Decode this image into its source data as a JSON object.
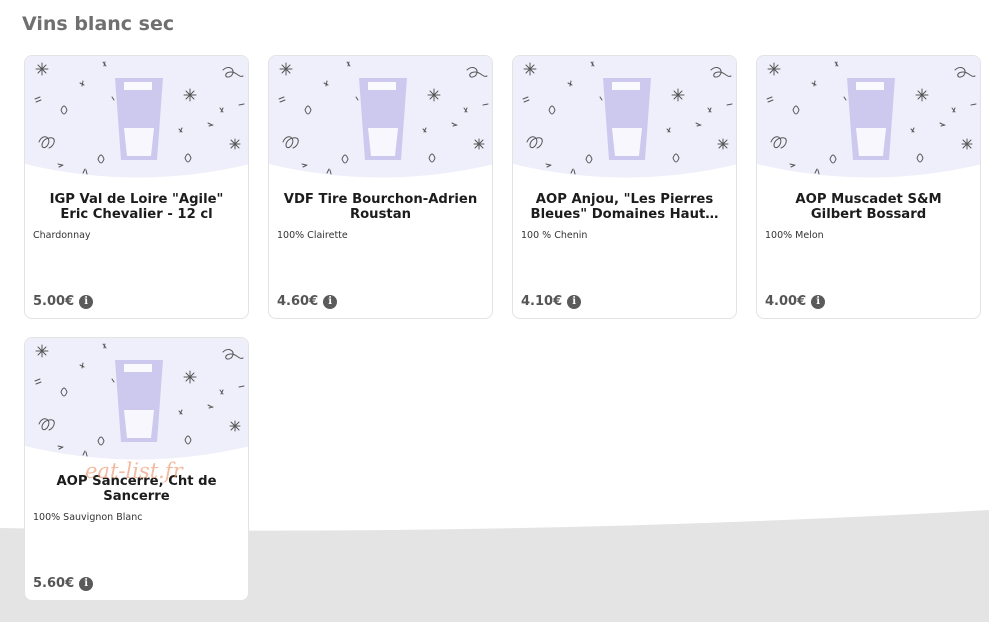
{
  "section": {
    "title": "Vins blanc sec"
  },
  "watermark": "eat-list.fr",
  "colors": {
    "art_bg": "#efeefb",
    "glass": "#cdc9ee",
    "doodle": "#555555"
  },
  "products": [
    {
      "name": "IGP Val de Loire \"Agile\" Eric Chevalier - 12 cl",
      "description": "Chardonnay",
      "price": "5.00€",
      "image_icon": "wine-glass-icon",
      "info_icon": "info-icon"
    },
    {
      "name": "VDF Tire Bourchon-Adrien Roustan",
      "description": "100% Clairette",
      "price": "4.60€",
      "image_icon": "wine-glass-icon",
      "info_icon": "info-icon"
    },
    {
      "name": "AOP Anjou, \"Les Pierres Bleues\" Domaines Haut…",
      "description": "100 % Chenin",
      "price": "4.10€",
      "image_icon": "wine-glass-icon",
      "info_icon": "info-icon"
    },
    {
      "name": "AOP Muscadet S&M Gilbert Bossard",
      "description": "100% Melon",
      "price": "4.00€",
      "image_icon": "wine-glass-icon",
      "info_icon": "info-icon"
    },
    {
      "name": "AOP Sancerre, Cht de Sancerre",
      "description": "100% Sauvignon Blanc",
      "price": "5.60€",
      "image_icon": "wine-glass-icon",
      "info_icon": "info-icon"
    }
  ]
}
